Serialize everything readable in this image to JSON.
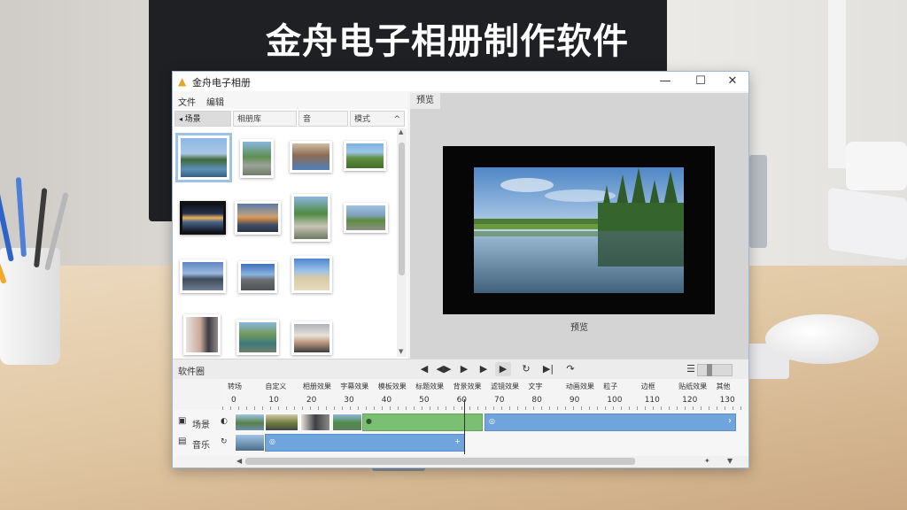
{
  "headline": "金舟电子相册制作软件",
  "window": {
    "title": "金舟电子相册",
    "controls": {
      "minimize": "—",
      "maximize": "☐",
      "close": "✕"
    }
  },
  "menu": [
    "文件",
    "编辑"
  ],
  "left_panel": {
    "tabs": [
      "场景",
      "相册库",
      "音",
      "模式"
    ],
    "collapse_glyph": "^"
  },
  "preview": {
    "tab": "预览",
    "caption": "预览"
  },
  "transport": {
    "label": "软件圈",
    "buttons": [
      "◀",
      "◀▶",
      "▶",
      "▶",
      "▶",
      "↻",
      "▶|",
      "↷"
    ]
  },
  "ruler": {
    "labels": [
      "转场",
      "自定义",
      "相册效果",
      "字幕效果",
      "模板效果",
      "标题效果",
      "背景效果",
      "滤镜效果",
      "文字",
      "动画效果",
      "粒子",
      "边框",
      "贴纸效果",
      "其他"
    ],
    "numbers": [
      "0",
      "10",
      "20",
      "30",
      "40",
      "50",
      "60",
      "70",
      "80",
      "90",
      "100",
      "110",
      "120",
      "130"
    ]
  },
  "tracks": [
    {
      "name": "场景"
    },
    {
      "name": "音乐"
    }
  ],
  "colors": {
    "accent_blue": "#6fa4dc",
    "green_clip": "#7bbf73",
    "window_border": "#9fb8d6"
  }
}
